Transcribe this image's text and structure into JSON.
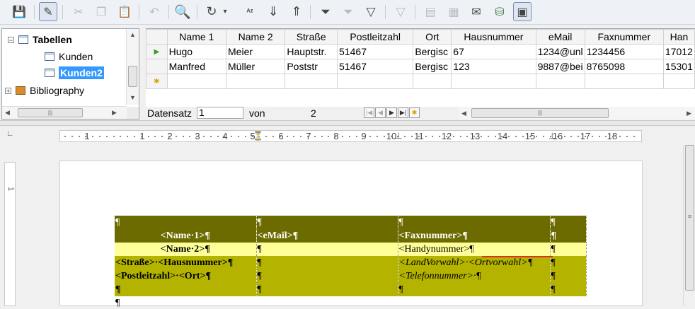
{
  "toolbar": {
    "icons": [
      "save-icon",
      "edit-mode-icon",
      "cut-icon",
      "copy-icon",
      "paste-icon",
      "undo-icon",
      "find-icon",
      "refresh-icon",
      "sort-icon",
      "sort-ascending-icon",
      "sort-descending-icon",
      "autofilter-icon",
      "standard-filter-icon",
      "apply-filter-icon",
      "remove-filter-icon",
      "data-to-text-icon",
      "data-to-fields-icon",
      "mail-merge-icon",
      "data-source-icon",
      "explorer-icon"
    ]
  },
  "navigator": {
    "root": "Tabellen",
    "items": [
      "Kunden",
      "Kunden2"
    ],
    "selected": "Kunden2",
    "other": "Bibliography"
  },
  "grid": {
    "columns": [
      "Name 1",
      "Name 2",
      "Straße",
      "Postleitzahl",
      "Ort",
      "Hausnummer",
      "eMail",
      "Faxnummer",
      "Han"
    ],
    "rows": [
      [
        "Hugo",
        "Meier",
        "Hauptstr.",
        "51467",
        "Bergisc",
        "67",
        "1234@unl",
        "1234456",
        "17012"
      ],
      [
        "Manfred",
        "Müller",
        "Poststr",
        "51467",
        "Bergisc",
        "123",
        "9887@bei",
        "8765098",
        "15301"
      ]
    ]
  },
  "record_nav": {
    "label": "Datensatz",
    "current": "1",
    "of_label": "von",
    "total": "2"
  },
  "ruler": {
    "numbers": [
      "1",
      "1",
      "2",
      "3",
      "4",
      "5",
      "6",
      "7",
      "8",
      "9",
      "10",
      "11",
      "12",
      "13",
      "14",
      "15",
      "16",
      "17",
      "18"
    ]
  },
  "label_table": {
    "pilcrow": "¶",
    "rows": [
      {
        "style": "dark",
        "cells": [
          "¶",
          "¶",
          "¶",
          "¶"
        ]
      },
      {
        "style": "dark",
        "cells": [
          "<Name·1>¶",
          "<eMail>¶",
          "<Faxnummer>¶",
          "¶"
        ]
      },
      {
        "style": "light",
        "cells": [
          "<Name·2>¶",
          "¶",
          "<Handynummer>¶",
          "¶"
        ]
      },
      {
        "style": "mid",
        "cells": [
          "<Straße>·<Hausnummer>¶",
          "¶",
          "<LandVorwahl>·<Ortvorwahl>¶",
          "¶"
        ]
      },
      {
        "style": "mid",
        "cells": [
          "<Postleitzahl>·<Ort>¶",
          "¶",
          "<Telefonnummer>·¶",
          "¶"
        ]
      },
      {
        "style": "mid",
        "cells": [
          "¶",
          "¶",
          "¶",
          "¶"
        ]
      }
    ],
    "trailing": "¶"
  },
  "colors": {
    "dark": "#6b6b00",
    "light": "#ffff99",
    "mid": "#b3b300",
    "selection": "#3399ff"
  }
}
